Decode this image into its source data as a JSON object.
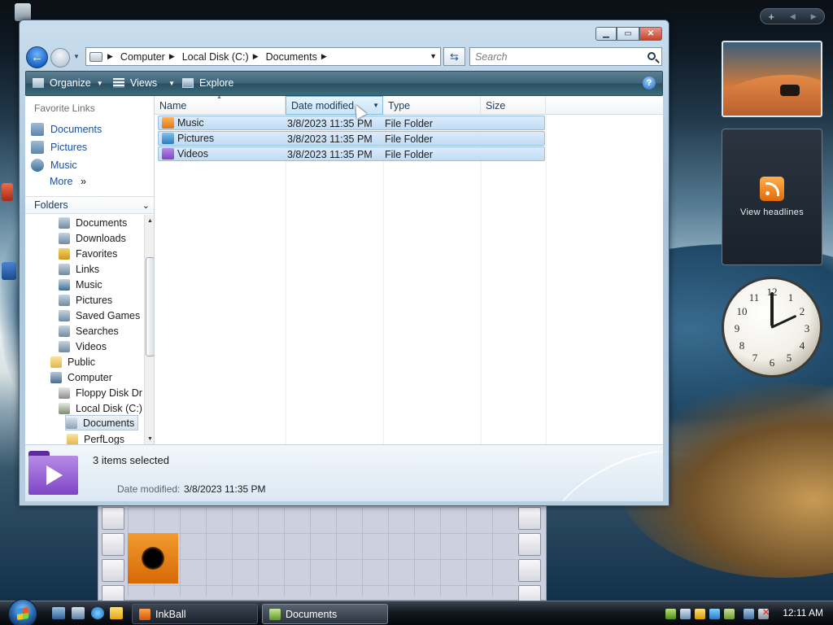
{
  "window": {
    "address": {
      "crumbs": [
        "Computer",
        "Local Disk (C:)",
        "Documents"
      ]
    },
    "search_placeholder": "Search",
    "toolbar": {
      "organize_label": "Organize",
      "views_label": "Views",
      "explore_label": "Explore"
    },
    "nav_pane": {
      "favorite_links_title": "Favorite Links",
      "favorites": [
        {
          "label": "Documents",
          "icon": "documents-icon"
        },
        {
          "label": "Pictures",
          "icon": "pictures-icon"
        },
        {
          "label": "Music",
          "icon": "music-icon"
        }
      ],
      "more_label": "More",
      "folders_title": "Folders",
      "tree": [
        {
          "label": "Documents",
          "icon": "documents-icon"
        },
        {
          "label": "Downloads",
          "icon": "downloads-icon"
        },
        {
          "label": "Favorites",
          "icon": "favorites-icon"
        },
        {
          "label": "Links",
          "icon": "links-icon"
        },
        {
          "label": "Music",
          "icon": "music-icon"
        },
        {
          "label": "Pictures",
          "icon": "pictures-icon"
        },
        {
          "label": "Saved Games",
          "icon": "saved-games-icon"
        },
        {
          "label": "Searches",
          "icon": "searches-icon"
        },
        {
          "label": "Videos",
          "icon": "videos-icon"
        },
        {
          "label": "Public",
          "icon": "folder-icon"
        },
        {
          "label": "Computer",
          "icon": "computer-icon"
        },
        {
          "label": "Floppy Disk Dr",
          "icon": "floppy-drive-icon"
        },
        {
          "label": "Local Disk (C:)",
          "icon": "local-disk-icon"
        },
        {
          "label": "Documents",
          "icon": "documents-folder-icon",
          "selected": true
        },
        {
          "label": "PerfLogs",
          "icon": "folder-icon"
        }
      ]
    },
    "list": {
      "columns": [
        "Name",
        "Date modified",
        "Type",
        "Size"
      ],
      "rows": [
        {
          "name": "Music",
          "date": "3/8/2023 11:35 PM",
          "type": "File Folder",
          "icon": "music-folder-icon",
          "selected": true
        },
        {
          "name": "Pictures",
          "date": "3/8/2023 11:35 PM",
          "type": "File Folder",
          "icon": "pictures-folder-icon",
          "selected": true
        },
        {
          "name": "Videos",
          "date": "3/8/2023 11:35 PM",
          "type": "File Folder",
          "icon": "videos-folder-icon",
          "selected": true
        }
      ]
    },
    "details": {
      "count": "3 items selected",
      "date_label": "Date modified:",
      "date_value": "3/8/2023 11:35 PM"
    }
  },
  "sidebar": {
    "feed_label": "View headlines"
  },
  "clock_face": {
    "numbers": [
      "12",
      "1",
      "2",
      "3",
      "4",
      "5",
      "6",
      "7",
      "8",
      "9",
      "10",
      "11"
    ]
  },
  "taskbar": {
    "buttons": [
      {
        "label": "InkBall",
        "icon": "inkball-icon"
      },
      {
        "label": "Documents",
        "icon": "explorer-folder-icon",
        "active": true
      }
    ],
    "clock": "12:11 AM"
  },
  "colors": {
    "toolbar_bg": "#3e6579",
    "link_blue": "#1a4fa1",
    "selection": "#c1dcf3",
    "video_folder": "#7f45c6"
  }
}
